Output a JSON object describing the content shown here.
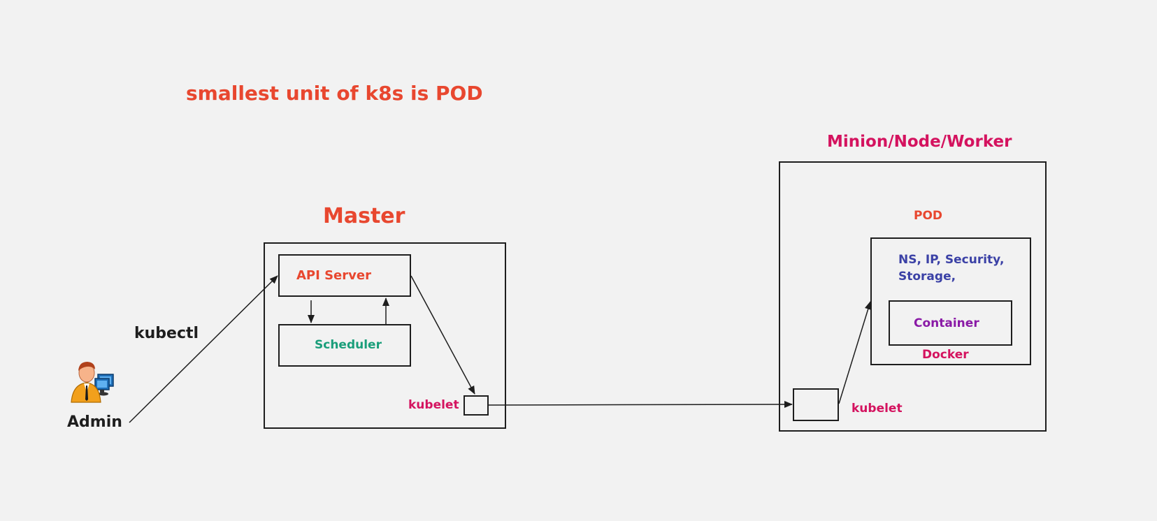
{
  "title": "smallest unit of k8s is POD",
  "colors": {
    "title": "#e8472f",
    "master_title": "#e8472f",
    "api_server": "#e8472f",
    "scheduler": "#1a9e7a",
    "kubelet": "#d4135f",
    "worker_title": "#d4135f",
    "pod_label": "#e8472f",
    "pod_features": "#3b41a6",
    "container": "#8a1aa6",
    "docker": "#d4135f",
    "admin": "#1e1e1e",
    "kubectl": "#1e1e1e"
  },
  "admin": {
    "label": "Admin",
    "icon": "admin-user-computer-icon"
  },
  "kubectl_label": "kubectl",
  "master": {
    "title": "Master",
    "api_server": "API Server",
    "scheduler": "Scheduler",
    "kubelet": "kubelet"
  },
  "worker": {
    "title": "Minion/Node/Worker",
    "pod_label": "POD",
    "pod_features_line1": "NS, IP, Security,",
    "pod_features_line2": "Storage,",
    "container": "Container",
    "docker": "Docker",
    "kubelet": "kubelet"
  }
}
